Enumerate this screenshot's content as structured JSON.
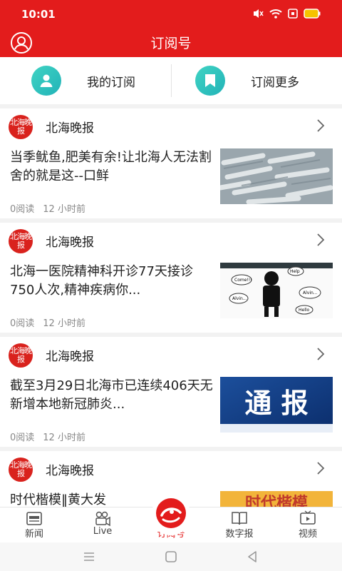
{
  "status_bar": {
    "time": "10:01",
    "icons": [
      "mute-icon",
      "wifi-icon",
      "sim-icon",
      "battery-icon"
    ]
  },
  "header": {
    "title": "订阅号",
    "user_icon": "user-circle-icon"
  },
  "subscription_bar": {
    "my_subscriptions_label": "我的订阅",
    "more_subscriptions_label": "订阅更多",
    "accent": "#2ec4bd"
  },
  "articles": [
    {
      "source": "北海晚报",
      "logo_text": "北海晚报",
      "title": "当季鱿鱼,肥美有余!让北海人无法割舍的就是这--口鲜",
      "reads": "0阅读",
      "time": "12 小时前",
      "thumb": "squid-photo"
    },
    {
      "source": "北海晚报",
      "logo_text": "北海晚报",
      "title": "北海一医院精神科开诊77天接诊750人次,精神疾病你...",
      "reads": "0阅读",
      "time": "12 小时前",
      "thumb": "stressed-figure-illustration",
      "bubbles": [
        "Help",
        "Come!!!",
        "Alvin...",
        "Alvin...",
        "Hello"
      ]
    },
    {
      "source": "北海晚报",
      "logo_text": "北海晚报",
      "title": "截至3月29日北海市已连续406天无新增本地新冠肺炎...",
      "reads": "0阅读",
      "time": "12 小时前",
      "thumb": "notice-banner",
      "thumb_text": "通 报"
    },
    {
      "source": "北海晚报",
      "logo_text": "北海晚报",
      "title": "时代楷模‖黄大发",
      "thumb": "era-model-banner",
      "thumb_text": "时代楷模"
    }
  ],
  "bottom_nav": {
    "items": [
      {
        "label": "新闻",
        "icon": "news-icon"
      },
      {
        "label": "Live",
        "icon": "video-camera-icon"
      },
      {
        "label": "订阅号",
        "icon": "subscription-logo-icon"
      },
      {
        "label": "数字报",
        "icon": "book-icon"
      },
      {
        "label": "视频",
        "icon": "tv-icon"
      }
    ],
    "active_index": 2,
    "active_color": "#e31c1c"
  },
  "system_nav": [
    "menu-icon",
    "home-icon",
    "back-icon"
  ],
  "colors": {
    "brand_red": "#e31c1c",
    "teal": "#2ec4bd"
  }
}
